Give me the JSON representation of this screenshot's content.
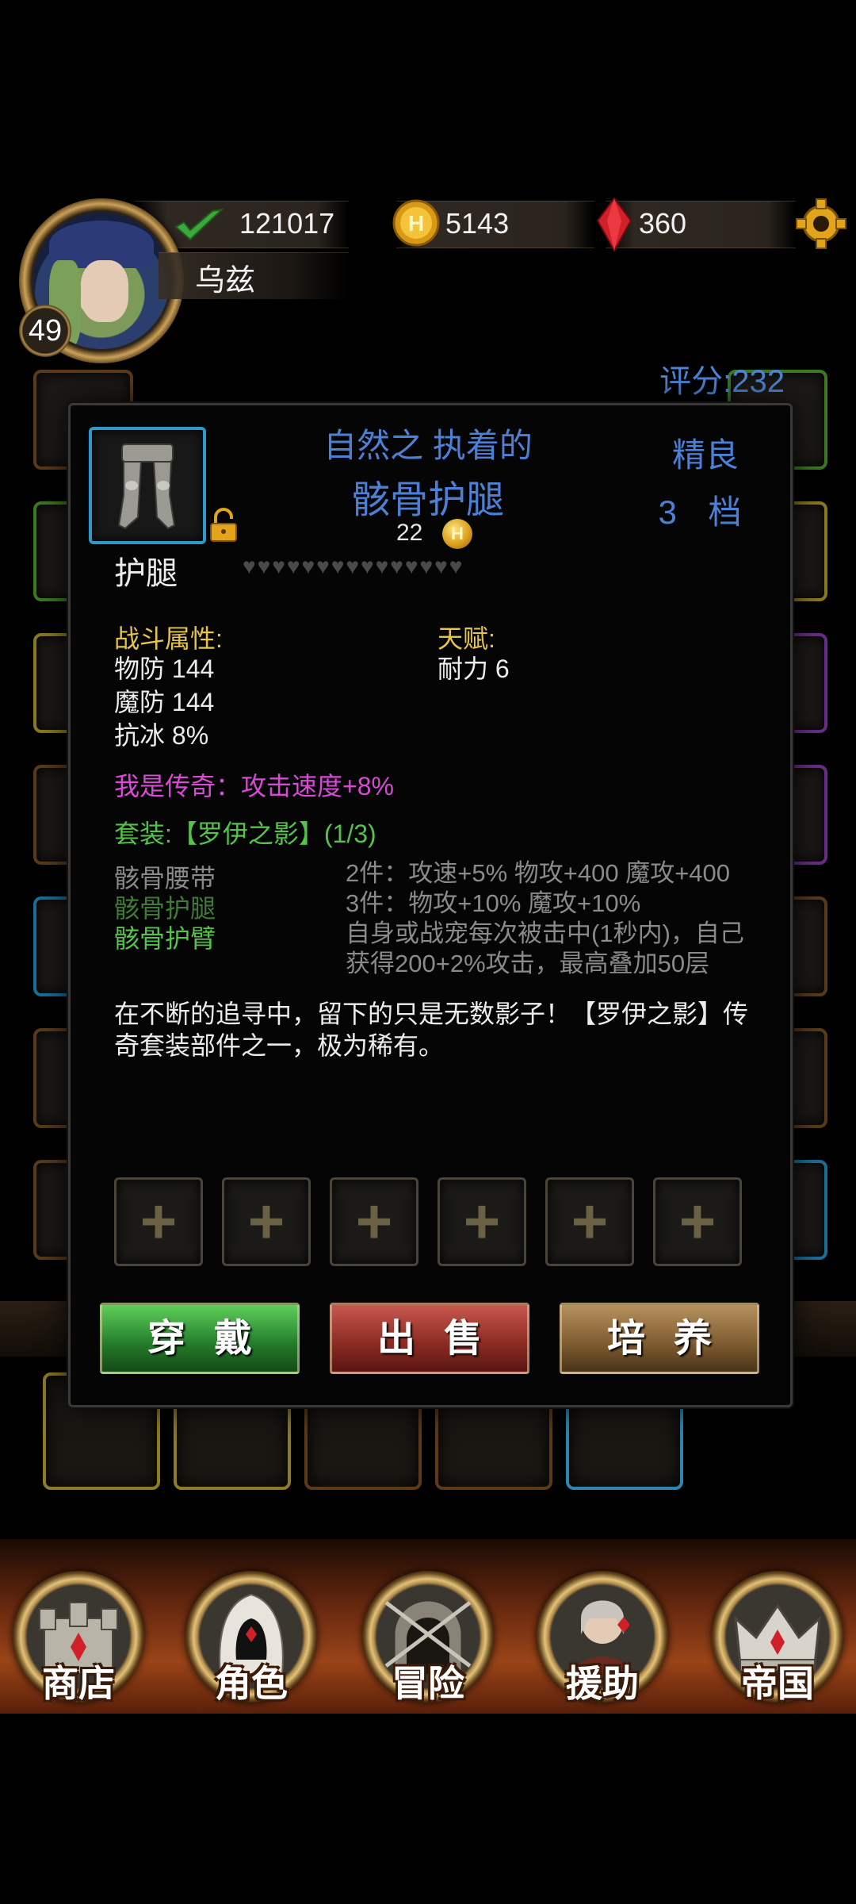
{
  "hud": {
    "power": "121017",
    "gold": "5143",
    "gems": "360",
    "player_name": "乌兹",
    "level": "49",
    "icons": {
      "power": "check-icon",
      "gold": "coin-icon",
      "gems": "red-gem-icon",
      "settings": "gear-icon"
    }
  },
  "score": "评分:232",
  "item": {
    "prefix": "自然之 执着的",
    "name": "骸骨护腿",
    "quality": "精良",
    "tier": "3 档",
    "price": "22",
    "coin_letter": "H",
    "slot_type": "护腿",
    "hearts": "♥♥♥♥♥♥♥♥♥♥♥♥♥♥♥",
    "combat_label": "战斗属性:",
    "stats": [
      "物防 144",
      "魔防 144",
      "抗冰 8%"
    ],
    "talent_label": "天赋:",
    "talents": [
      "耐力 6"
    ],
    "legend": "我是传奇：攻击速度+8%",
    "set_title": "套装:【罗伊之影】(1/3)",
    "set_pieces": [
      {
        "name": "骸骨腰带",
        "color": "#8a8a8a"
      },
      {
        "name": "骸骨护腿",
        "color": "#3f7a36"
      },
      {
        "name": "骸骨护臂",
        "color": "#55c24a"
      }
    ],
    "set_bonuses": [
      "2件：攻速+5% 物攻+400 魔攻+400",
      "3件：物攻+10% 魔攻+10%",
      "自身或战宠每次被击中(1秒内)，自己获得200+2%攻击，最高叠加50层"
    ],
    "description": "在不断的追寻中，留下的只是无数影子！【罗伊之影】传奇套装部件之一，极为稀有。",
    "gem_slot_symbol": "+"
  },
  "actions": {
    "wear": "穿戴",
    "sell": "出售",
    "train": "培养"
  },
  "nav": [
    "商店",
    "角色",
    "冒险",
    "援助",
    "帝国"
  ]
}
